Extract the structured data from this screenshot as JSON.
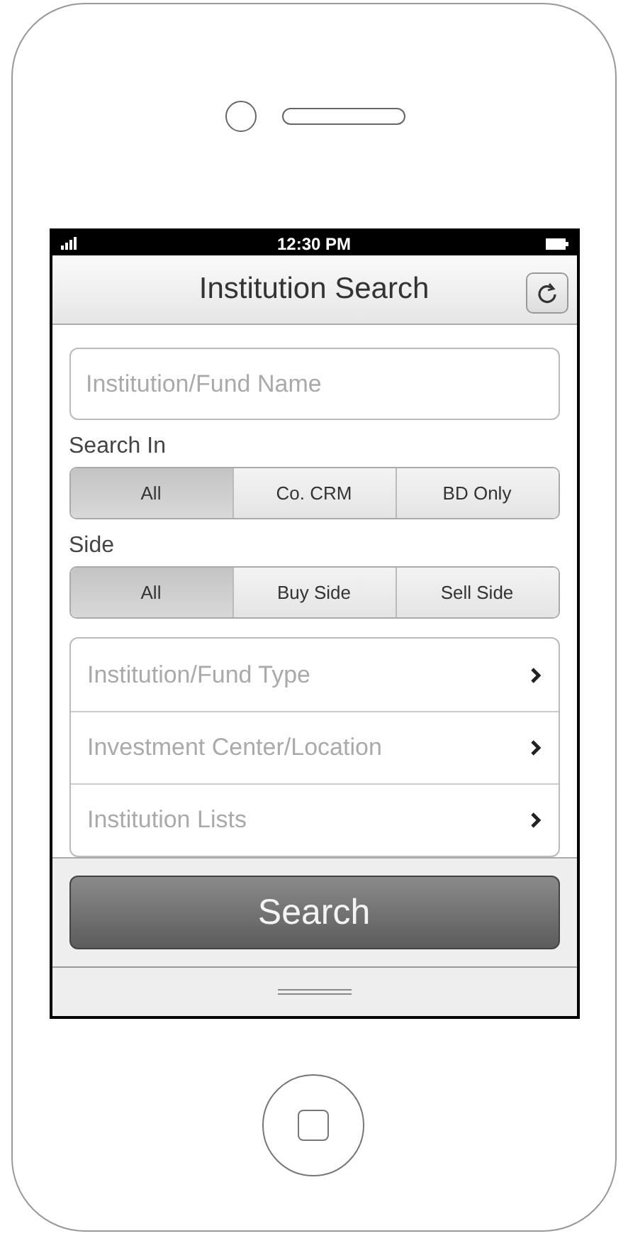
{
  "status_bar": {
    "time": "12:30 PM"
  },
  "nav_bar": {
    "title": "Institution Search"
  },
  "search_field": {
    "placeholder": "Institution/Fund Name"
  },
  "segments": [
    {
      "label": "Search In",
      "options": [
        {
          "label": "All",
          "selected": true
        },
        {
          "label": "Co. CRM",
          "selected": false
        },
        {
          "label": "BD Only",
          "selected": false
        }
      ]
    },
    {
      "label": "Side",
      "options": [
        {
          "label": "All",
          "selected": true
        },
        {
          "label": "Buy Side",
          "selected": false
        },
        {
          "label": "Sell Side",
          "selected": false
        }
      ]
    }
  ],
  "filters": [
    {
      "label": "Institution/Fund Type"
    },
    {
      "label": "Investment Center/Location"
    },
    {
      "label": "Institution Lists"
    }
  ],
  "search_button": {
    "label": "Search"
  }
}
